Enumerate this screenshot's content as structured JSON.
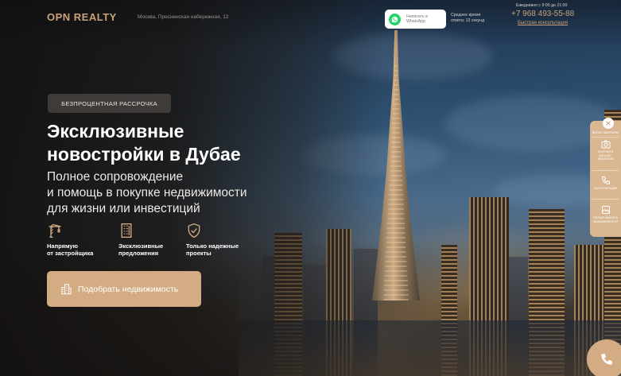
{
  "header": {
    "logo": "OPN REALTY",
    "address": "Москва, Пресненская набережная, 12",
    "whatsapp_button": "Написать в WhatsApp",
    "response_time": "Среднее время ответа: 13 секунд",
    "work_hours": "Ежедневно с 9:00 до 21:00",
    "phone": "+7 968 493-55-88",
    "fast_consult": "Быстрая консультация"
  },
  "hero": {
    "badge": "БЕЗПРОЦЕНТНАЯ РАССРОЧКА",
    "title_line1": "Эксклюзивные",
    "title_line2": "новостройки в Дубае",
    "subtitle_line1": "Полное сопровождение",
    "subtitle_line2": "и помощь в покупке недвижимости",
    "subtitle_line3": "для жизни или инвестиций",
    "features": [
      {
        "icon": "crane-icon",
        "line1": "Напрямую",
        "line2": "от застройщика"
      },
      {
        "icon": "building-icon",
        "line1": "Эксклюзивные",
        "line2": "предложения"
      },
      {
        "icon": "shield-check-icon",
        "line1": "Только надежные",
        "line2": "проекты"
      }
    ],
    "cta_label": "Подобрать недвижимость"
  },
  "side_panel": {
    "items": [
      {
        "icon": "close-icon",
        "label": "Закрыть"
      },
      {
        "icon": "camera-icon",
        "label": "ПОЛУЧИТЬ КАТАЛОГ ОБЪЕКТОВ"
      },
      {
        "icon": "phone-icon",
        "label": "КОНСУЛЬТАЦИЯ"
      },
      {
        "icon": "gallery-icon",
        "label": "ПОЛЬЗА ВЫБОРА НЕДВИЖИМОСТИ"
      }
    ],
    "first_label": "ВЫБОР КВАРТИРЫ"
  },
  "colors": {
    "accent": "#d3ac84",
    "gold_text": "#c9a27a",
    "whatsapp": "#25d366",
    "badge_bg": "#46423f"
  }
}
